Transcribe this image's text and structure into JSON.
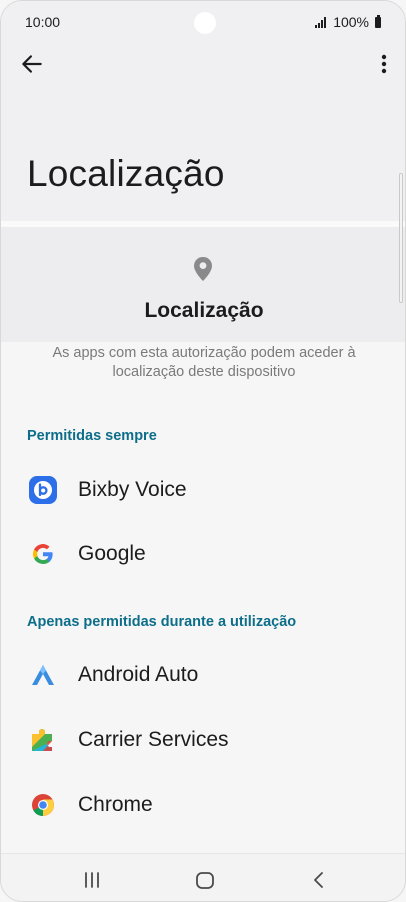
{
  "status_bar": {
    "time": "10:00",
    "battery": "100%"
  },
  "app_bar": {
    "back_icon": "arrow-left-icon",
    "more_icon": "more-vertical-icon"
  },
  "page": {
    "title": "Localização",
    "header_icon": "location-pin-icon",
    "header_title": "Localização",
    "description": "As apps com esta autorização podem aceder à localização deste dispositivo"
  },
  "sections": [
    {
      "title": "Permitidas sempre",
      "apps": [
        {
          "name": "Bixby Voice",
          "icon": "bixby-voice-icon"
        },
        {
          "name": "Google",
          "icon": "google-icon"
        }
      ]
    },
    {
      "title": "Apenas permitidas durante a utilização",
      "apps": [
        {
          "name": "Android Auto",
          "icon": "android-auto-icon"
        },
        {
          "name": "Carrier Services",
          "icon": "carrier-services-icon"
        },
        {
          "name": "Chrome",
          "icon": "chrome-icon"
        }
      ]
    }
  ],
  "nav_bar": {
    "recents_icon": "recents-icon",
    "home_icon": "home-icon",
    "back_icon": "back-chevron-icon"
  },
  "colors": {
    "section_header": "#0d6e8a",
    "background": "#f6f6f6",
    "header_band": "#f0f0f3"
  }
}
